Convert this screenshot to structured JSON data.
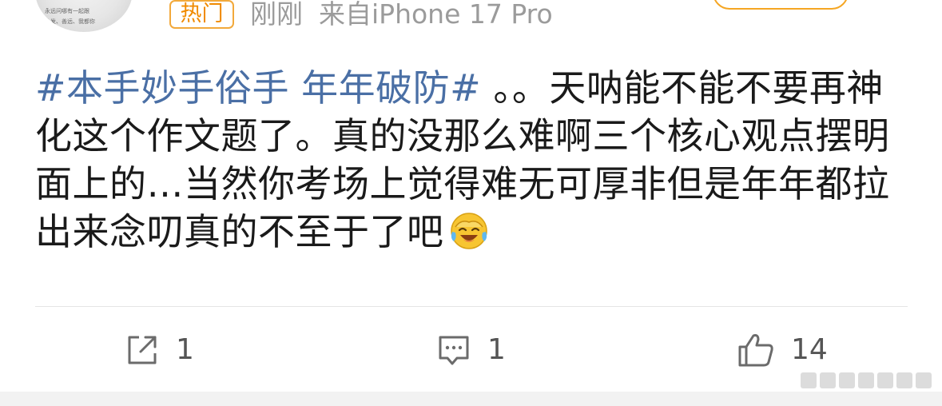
{
  "header": {
    "avatar_text_line1": "永远问哪有一起跟",
    "avatar_text_line2": "头发、善远、我都你",
    "hot_badge": "热门",
    "time": "刚刚",
    "source": "来自iPhone 17 Pro"
  },
  "post": {
    "topic": "#本手妙手俗手 年年破防#",
    "body": " 。。天呐能不能不要再神化这个作文题了。真的没那么难啊三个核心观点摆明面上的…当然你考场上觉得难无可厚非但是年年都拉出来念叨真的不至于了吧",
    "emoji": "laughing-crying-emoji"
  },
  "actions": {
    "share_count": "1",
    "comment_count": "1",
    "like_count": "14"
  },
  "colors": {
    "topic": "#4a6fa5",
    "hot_badge": "#f08a00",
    "meta": "#9b9b9b",
    "text": "#1a1a1a",
    "icon": "#6b6b6b"
  }
}
